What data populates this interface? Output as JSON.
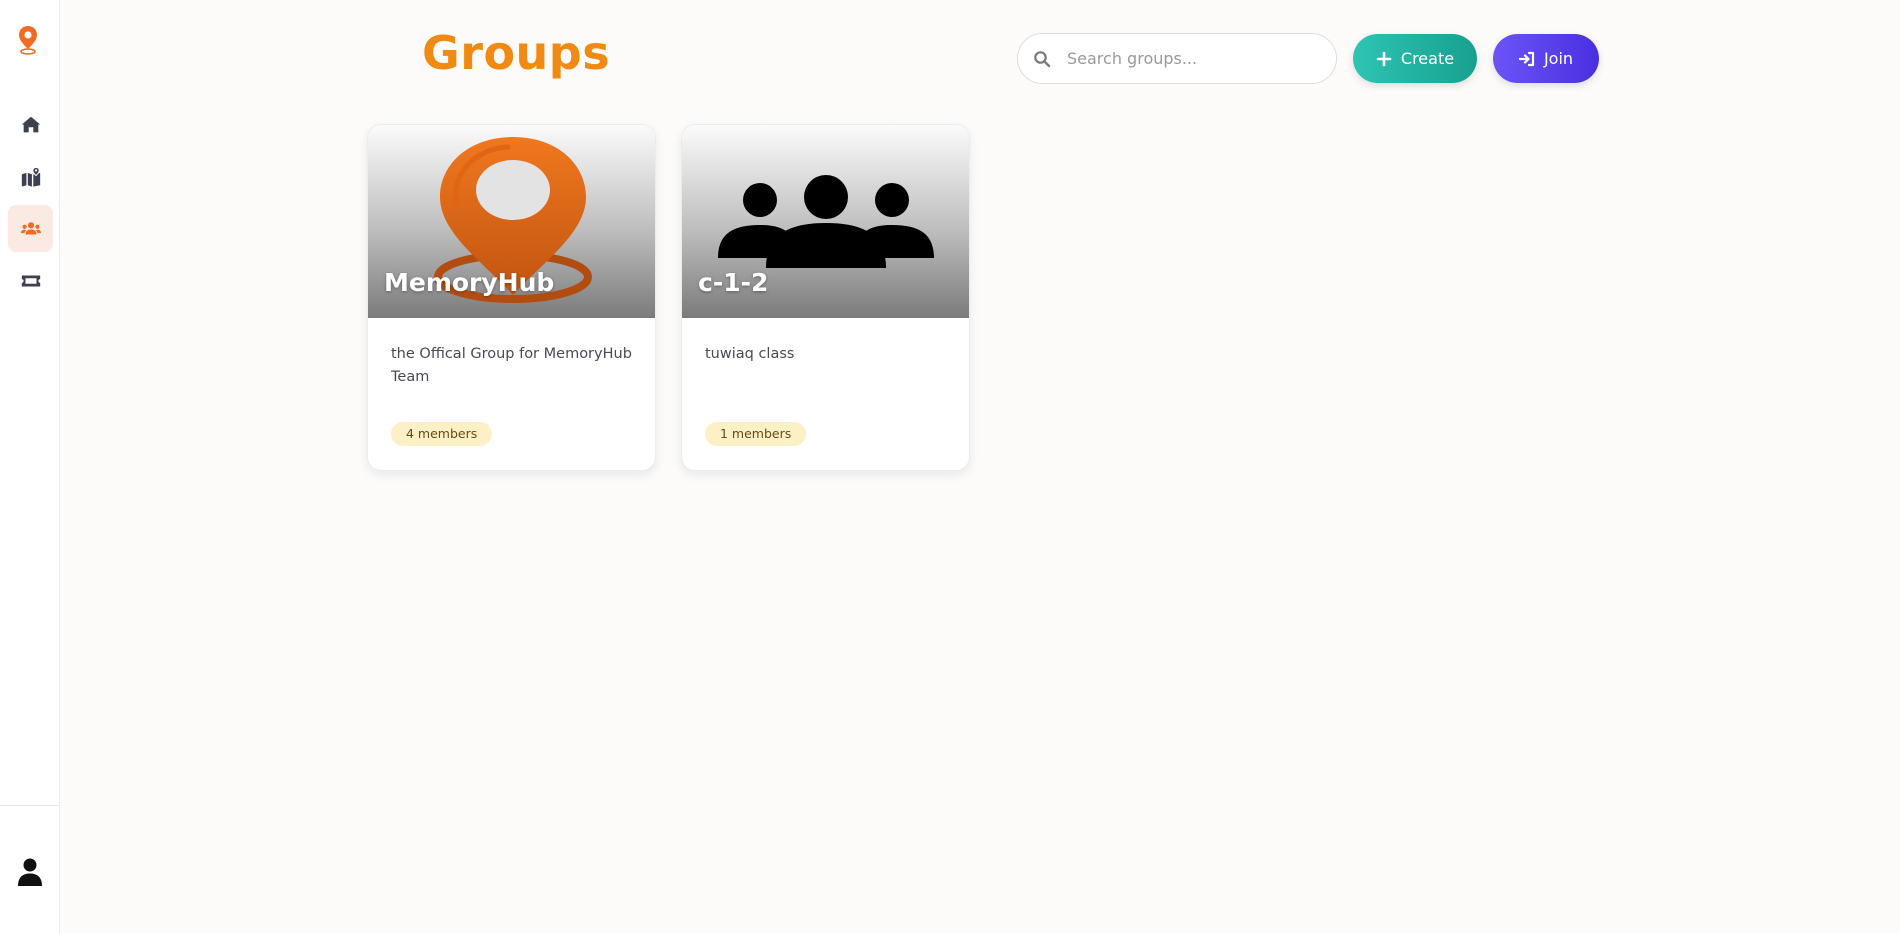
{
  "header": {
    "title": "Groups",
    "search_placeholder": "Search groups...",
    "search_value": "",
    "create_label": "Create",
    "join_label": "Join"
  },
  "sidebar": {
    "items": [
      {
        "name": "home",
        "icon": "home-icon",
        "active": false
      },
      {
        "name": "map",
        "icon": "map-location-icon",
        "active": false
      },
      {
        "name": "groups",
        "icon": "users-icon",
        "active": true
      },
      {
        "name": "tickets",
        "icon": "ticket-icon",
        "active": false
      }
    ],
    "accent": "#f26b22"
  },
  "groups": [
    {
      "name": "MemoryHub",
      "description": "the Offical Group for MemoryHub Team",
      "members": "4 members",
      "image_icon": "map-pin-icon"
    },
    {
      "name": "c-1-2",
      "description": "tuwiaq class",
      "members": "1 members",
      "image_icon": "users-group-icon"
    }
  ],
  "colors": {
    "title": "#f08a12",
    "create_button": "#1fb3a2",
    "join_button": "#5b43ec",
    "badge_bg": "#fdf0c7",
    "active_nav_bg": "#fbe9e4"
  }
}
